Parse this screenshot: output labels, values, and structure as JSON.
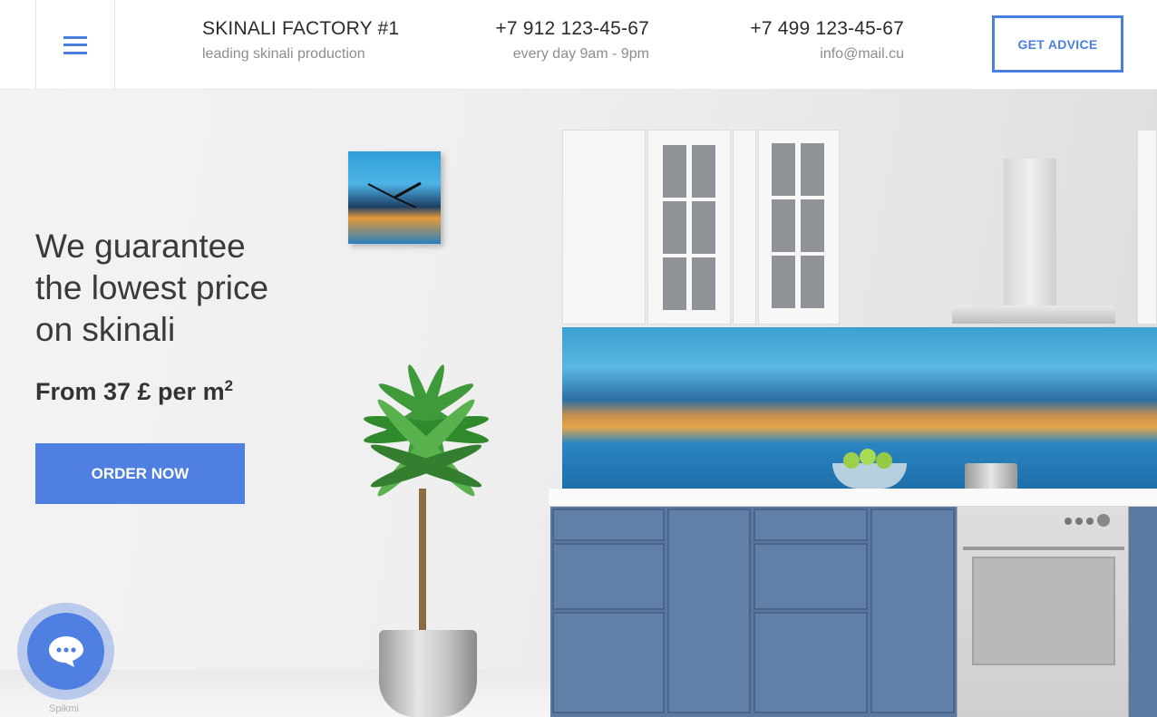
{
  "header": {
    "brand_title": "SKINALI FACTORY #1",
    "brand_subtitle": "leading skinali production",
    "phone_1": "+7 912 123-45-67",
    "phone_1_hours": "every day 9am - 9pm",
    "phone_2": "+7 499 123-45-67",
    "email": "info@mail.cu",
    "advice_button": "GET ADVICE"
  },
  "hero": {
    "headline_line1": "We guarantee",
    "headline_line2": "the lowest price",
    "headline_line3": "on skinali",
    "price_text": "From 37 £ per m",
    "price_superscript": "2",
    "order_button": "ORDER NOW"
  },
  "chat_widget": {
    "caption": "Spikmi",
    "icon": "chat-bubble-icon"
  },
  "colors": {
    "accent": "#4f80e1",
    "cabinet_blue": "#5b78a0"
  }
}
